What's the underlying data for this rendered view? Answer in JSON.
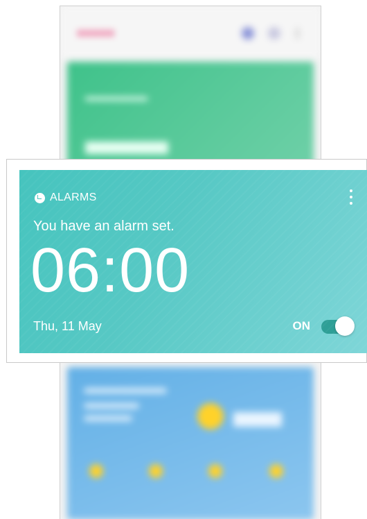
{
  "alarm": {
    "header_label": "ALARMS",
    "message": "You have an alarm set.",
    "time": "06:00",
    "date": "Thu, 11 May",
    "toggle_label": "ON",
    "toggle_on": true
  },
  "colors": {
    "card_gradient_start": "#46c4be",
    "card_gradient_end": "#7fd6d8",
    "toggle_track": "#2e9f96",
    "text": "#ffffff"
  },
  "icons": {
    "alarm": "alarm-clock-icon",
    "menu": "more-vertical-icon"
  }
}
